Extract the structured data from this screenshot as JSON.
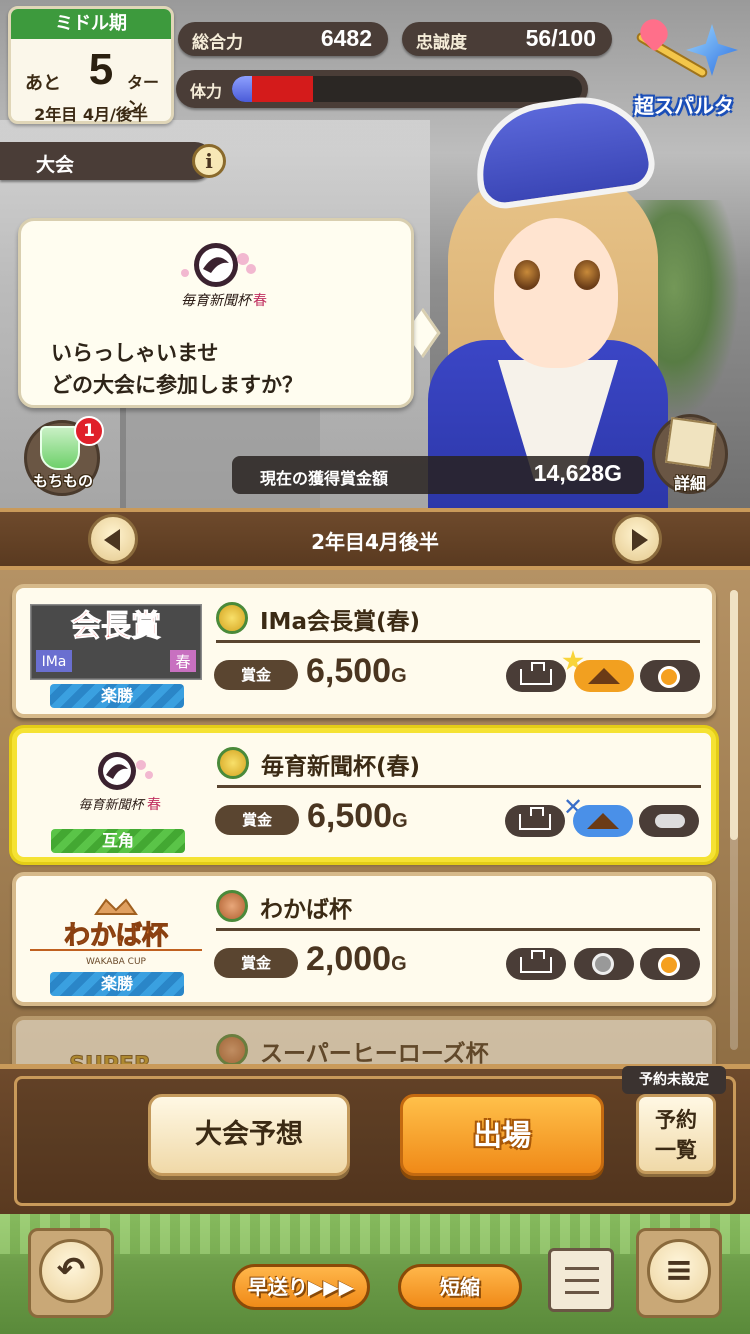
{
  "hud": {
    "turn_header": "ミドル期",
    "turn_prefix": "あと",
    "turns_left": "5",
    "turn_unit": "ターン",
    "date_year": "2年目",
    "date_month": "4月",
    "date_half": "後半",
    "total_power_label": "総合力",
    "total_power_value": "6482",
    "loyalty_label": "忠誠度",
    "loyalty_value": "56/100",
    "stamina_label": "体力",
    "stamina_fraction": 0.23,
    "sparta_label": "超スパルタ"
  },
  "event": {
    "tab_label": "大会",
    "info_icon": "i"
  },
  "dialog": {
    "logo_name": "毎育新聞杯",
    "logo_sub": "春",
    "line1": "いらっしゃいませ",
    "line2": "どの大会に参加しますか？"
  },
  "items": {
    "label": "もちもの",
    "badge": "1"
  },
  "prize": {
    "label": "現在の獲得賞金額",
    "value": "14,628G"
  },
  "detail": {
    "label": "詳細"
  },
  "date_nav": {
    "label": "2年目4月後半"
  },
  "races": [
    {
      "name": "IMa会長賞(春)",
      "logo_text": "会長賞",
      "logo_tag": "IMa",
      "logo_season": "春",
      "grade": "楽勝",
      "prize_label": "賞金",
      "prize_value": "6,500",
      "prize_unit": "G",
      "medal": "gold"
    },
    {
      "name": "毎育新聞杯(春)",
      "logo_text": "毎育新聞杯",
      "logo_tag": "",
      "logo_season": "春",
      "grade": "互角",
      "prize_label": "賞金",
      "prize_value": "6,500",
      "prize_unit": "G",
      "medal": "gold"
    },
    {
      "name": "わかば杯",
      "logo_text": "わかば杯",
      "logo_tag": "WAKABA CUP",
      "logo_season": "",
      "grade": "楽勝",
      "prize_label": "賞金",
      "prize_value": "2,000",
      "prize_unit": "G",
      "medal": "bronze"
    },
    {
      "name": "スーパーヒーローズ杯",
      "logo_text": "SUPER",
      "logo_tag": "",
      "logo_season": "",
      "grade": "",
      "prize_label": "",
      "prize_value": "",
      "prize_unit": "",
      "medal": "bronze"
    }
  ],
  "actions": {
    "forecast_label": "大会予想",
    "enter_label": "出場",
    "reserve_label": "予約\n一覧",
    "reserve_tag": "予約未設定"
  },
  "bottom": {
    "back_icon": "↶",
    "fast_forward_label": "早送り▶▶▶",
    "shorten_label": "短縮",
    "menu_icon": "≡"
  },
  "colors": {
    "accent_orange": "#f08a18",
    "frame_brown": "#5a3a20",
    "selected_outline": "#f5e233",
    "grade_easy": "#3aa0e0",
    "grade_even": "#5ac448",
    "stamina_red": "#d41b1b"
  }
}
